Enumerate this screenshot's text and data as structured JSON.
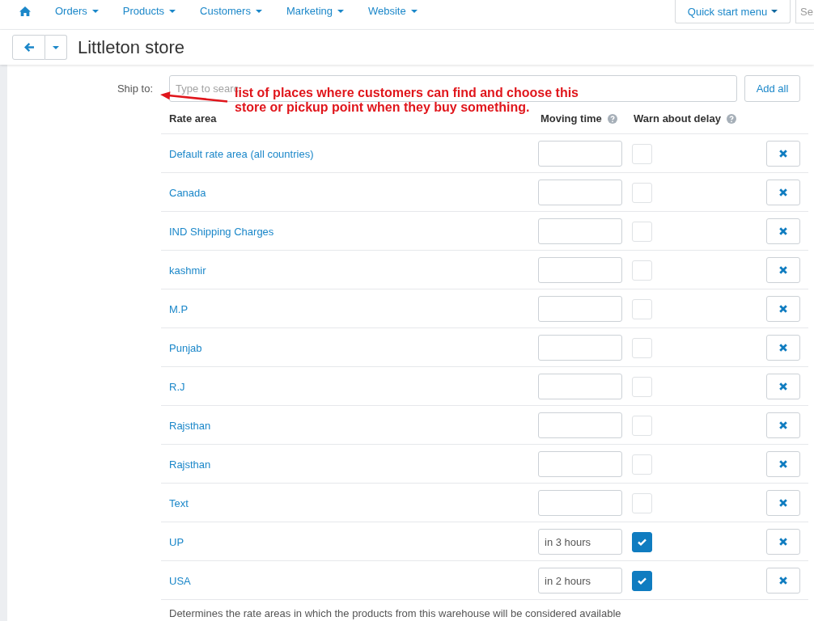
{
  "nav": {
    "menu": [
      "Orders",
      "Products",
      "Customers",
      "Marketing",
      "Website"
    ],
    "quick_start": "Quick start menu",
    "search": {
      "placeholder": "Se"
    }
  },
  "title": "Littleton store",
  "ship_to": {
    "label": "Ship to:",
    "placeholder": "Type to searc",
    "button": "Add all"
  },
  "annotation": {
    "lines": [
      "list of places where customers can find and choose this",
      "store or pickup point when they buy something."
    ]
  },
  "table": {
    "columns": [
      {
        "label": "Rate area",
        "help": false
      },
      {
        "label": "Moving time",
        "help": true
      },
      {
        "label": "Warn about delay",
        "help": true
      }
    ],
    "rows": [
      {
        "name": "Default rate area (all countries)",
        "warn_about_delay": false
      },
      {
        "name": "Canada",
        "warn_about_delay": false
      },
      {
        "name": "IND Shipping Charges",
        "warn_about_delay": false
      },
      {
        "name": "kashmir",
        "warn_about_delay": false
      },
      {
        "name": "M.P",
        "warn_about_delay": false
      },
      {
        "name": "Punjab",
        "warn_about_delay": false
      },
      {
        "name": "R.J",
        "warn_about_delay": false
      },
      {
        "name": "Rajsthan",
        "warn_about_delay": false
      },
      {
        "name": "Rajsthan",
        "warn_about_delay": false
      },
      {
        "name": "Text",
        "warn_about_delay": false
      },
      {
        "name": "UP",
        "moving_time": "in 3 hours",
        "warn_about_delay": true
      },
      {
        "name": "USA",
        "moving_time": "in 2 hours",
        "warn_about_delay": true
      }
    ]
  },
  "description": "Determines the rate areas in which the products from this warehouse will be considered available"
}
